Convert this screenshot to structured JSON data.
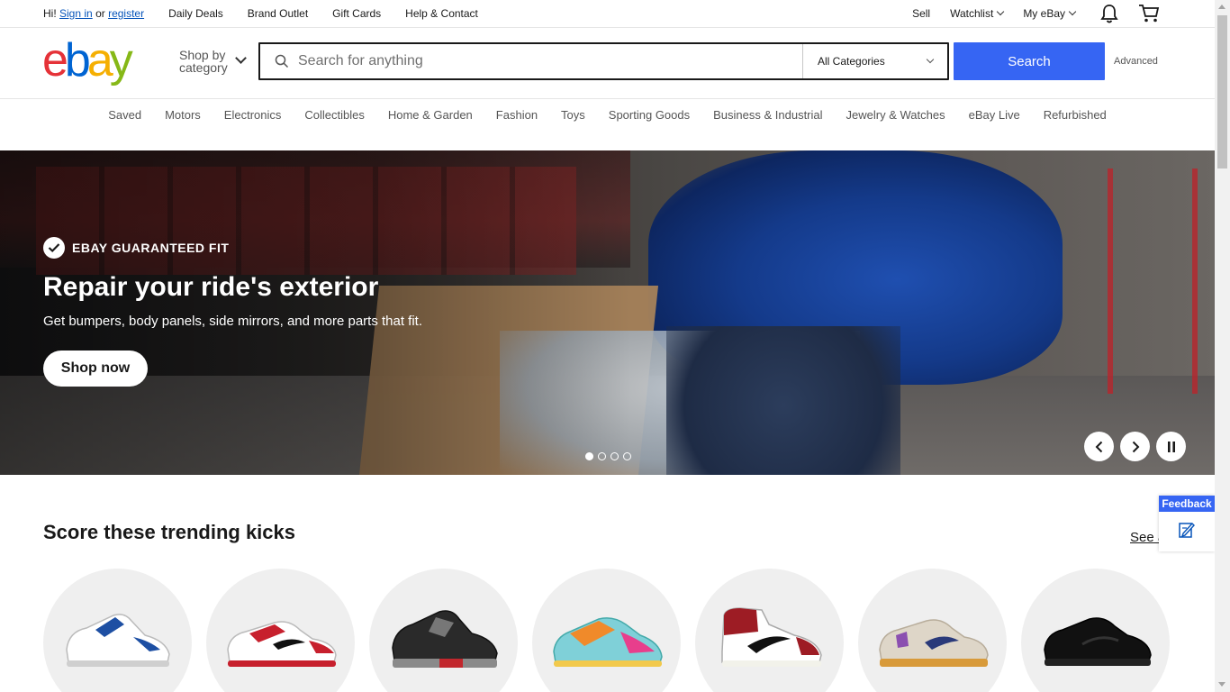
{
  "topbar": {
    "greeting": "Hi!",
    "sign_in": "Sign in",
    "or": "or",
    "register": "register",
    "links": [
      "Daily Deals",
      "Brand Outlet",
      "Gift Cards",
      "Help & Contact"
    ],
    "sell": "Sell",
    "watchlist": "Watchlist",
    "my_ebay": "My eBay",
    "icons": [
      "bell-icon",
      "cart-icon"
    ]
  },
  "header": {
    "logo_letters": [
      "e",
      "b",
      "a",
      "y"
    ],
    "logo_colors": [
      "#e53238",
      "#0064d2",
      "#f5af02",
      "#86b817"
    ],
    "shop_by_line1": "Shop by",
    "shop_by_line2": "category",
    "search_placeholder": "Search for anything",
    "category_select": "All Categories",
    "search_button": "Search",
    "advanced": "Advanced"
  },
  "category_nav": [
    "Saved",
    "Motors",
    "Electronics",
    "Collectibles",
    "Home & Garden",
    "Fashion",
    "Toys",
    "Sporting Goods",
    "Business & Industrial",
    "Jewelry & Watches",
    "eBay Live",
    "Refurbished"
  ],
  "hero": {
    "badge": "EBAY GUARANTEED FIT",
    "title": "Repair your ride's exterior",
    "subtitle": "Get bumpers, body panels, side mirrors, and more parts that fit.",
    "cta": "Shop now",
    "slides_total": 4,
    "active_slide": 1
  },
  "trending": {
    "title": "Score these trending kicks",
    "see_all": "See all",
    "items": [
      {
        "name": "shoe-1",
        "colors": [
          "#ffffff",
          "#1d4fa3",
          "#c9c9c9"
        ]
      },
      {
        "name": "shoe-2",
        "colors": [
          "#ffffff",
          "#c7202d",
          "#111111"
        ]
      },
      {
        "name": "shoe-3",
        "colors": [
          "#2a2a2a",
          "#777777",
          "#c2272d"
        ]
      },
      {
        "name": "shoe-4",
        "colors": [
          "#7fd0d8",
          "#f08a2a",
          "#e83e8c"
        ]
      },
      {
        "name": "shoe-5",
        "colors": [
          "#9d1c24",
          "#ffffff",
          "#111111"
        ]
      },
      {
        "name": "shoe-6",
        "colors": [
          "#ded6c8",
          "#2a3a7a",
          "#d89a3a"
        ]
      },
      {
        "name": "shoe-7",
        "colors": [
          "#111111",
          "#222222",
          "#333333"
        ]
      }
    ]
  },
  "feedback": {
    "label": "Feedback"
  },
  "colors": {
    "accent": "#3665f3",
    "link": "#0654ba"
  }
}
